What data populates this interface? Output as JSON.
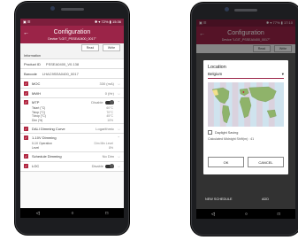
{
  "left": {
    "status": {
      "left": "▣ ☰",
      "right": "✱ ▾ 72% ▮ 15:36"
    },
    "appbar": {
      "title": "Configuration",
      "subtitle": "Device \"LGIT_PSSEA0400_0017\""
    },
    "tabs": [
      "Read",
      "Write"
    ],
    "section": "Information",
    "product_id": {
      "label": "Product ID",
      "value": "PSSEA0400_V0.138"
    },
    "barcode": {
      "label": "Barcode",
      "value": "LHAC9SEA0400_0017"
    },
    "items": [
      {
        "label": "MOC",
        "value": "330 (mA)"
      },
      {
        "label": "MWH",
        "value": "0 (Hr)"
      }
    ],
    "mtp": {
      "label": "MTP",
      "value": "Disable",
      "rows": [
        {
          "label": "Tstart (°C)",
          "value": "60°C"
        },
        {
          "label": "Tstop (°C)",
          "value": "70°C"
        },
        {
          "label": "Tdrop (°C)",
          "value": "45°C"
        },
        {
          "label": "Dim (%)",
          "value": "10%"
        }
      ]
    },
    "dali": {
      "label": "DALI Dimming Curve",
      "value": "Logarithmic"
    },
    "dimming_1_10": {
      "label": "1-10V Dimming",
      "rows": [
        {
          "label": "0-1V Operation",
          "value": "Dim Min Level"
        },
        {
          "label": "Level",
          "value": "8%"
        }
      ]
    },
    "schedule": {
      "label": "Schedule Dimming",
      "value": "No Dim"
    },
    "loc": {
      "label": "LOC",
      "value": "Disable"
    },
    "nav": [
      "◁",
      "○",
      "□"
    ]
  },
  "right": {
    "status": {
      "left": "▣ ☰",
      "right": "✱ ▾ 77% ▮ 17:10"
    },
    "appbar": {
      "title": "Configuration",
      "subtitle": "Device \"LGIT_PSSEA0400_0017\""
    },
    "tabs": [
      "Read",
      "Write"
    ],
    "dialog": {
      "title": "Location",
      "country": "Belgium",
      "daylight_label": "Daylight Saving",
      "midnight_text": "Calculated Midnight Shift(m) : 41",
      "ok": "OK",
      "cancel": "CANCEL"
    },
    "bottom_buttons": [
      "NEW SCHEDULE",
      "ADD"
    ],
    "nav": [
      "◁",
      "○",
      "□"
    ]
  }
}
